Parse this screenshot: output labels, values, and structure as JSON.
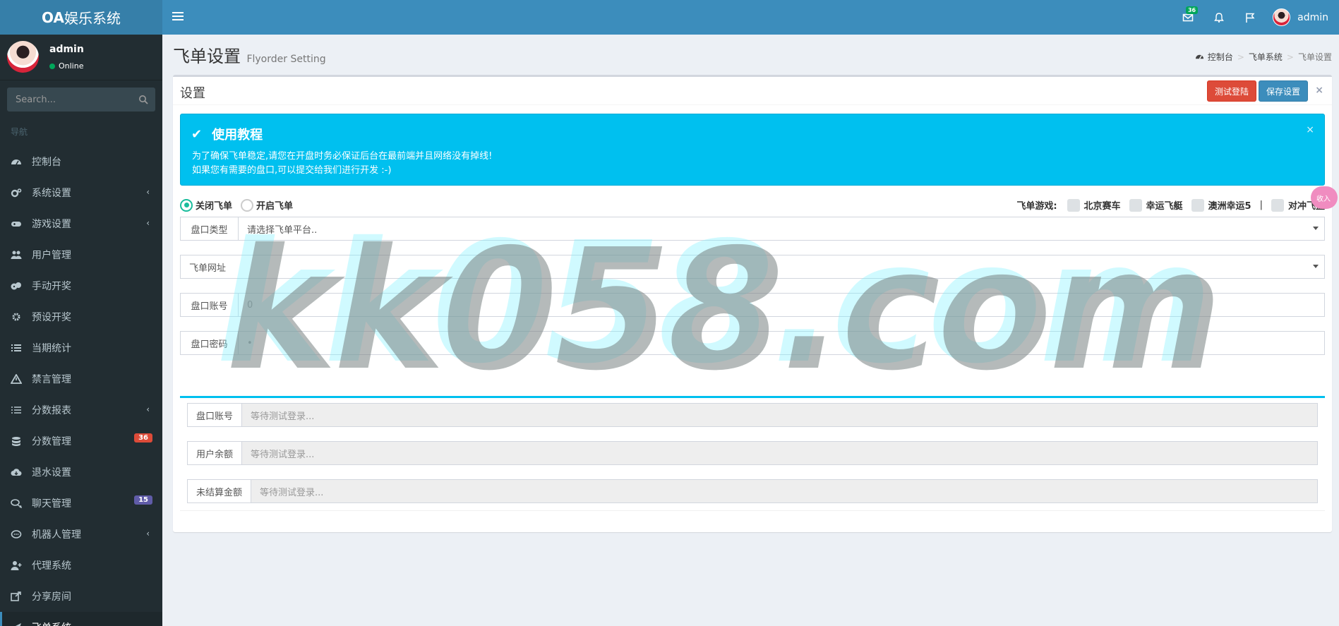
{
  "app": {
    "brand_bold": "OA",
    "brand_rest": "娱乐系统"
  },
  "topbar": {
    "mail_badge": "36",
    "user": "admin",
    "icons": [
      "menu-icon",
      "mail-icon",
      "bell-icon",
      "flag-icon"
    ]
  },
  "sidebar": {
    "user": {
      "name": "admin",
      "status": "Online"
    },
    "search_placeholder": "Search...",
    "nav_header": "导航",
    "items": [
      {
        "label": "控制台",
        "icon": "dashboard-icon"
      },
      {
        "label": "系统设置",
        "icon": "cogs-icon",
        "chevron": "‹"
      },
      {
        "label": "游戏设置",
        "icon": "gamepad-icon",
        "chevron": "‹"
      },
      {
        "label": "用户管理",
        "icon": "users-icon"
      },
      {
        "label": "手动开奖",
        "icon": "dice-icon"
      },
      {
        "label": "预设开奖",
        "icon": "gear-icon"
      },
      {
        "label": "当期统计",
        "icon": "list-icon"
      },
      {
        "label": "禁言管理",
        "icon": "warning-icon"
      },
      {
        "label": "分数报表",
        "icon": "list-ol-icon",
        "chevron": "‹"
      },
      {
        "label": "分数管理",
        "icon": "database-icon",
        "badge": "36",
        "badge_color": "#dd4b39"
      },
      {
        "label": "退水设置",
        "icon": "cloud-download-icon"
      },
      {
        "label": "聊天管理",
        "icon": "comments-icon",
        "badge": "15",
        "badge_color": "#605ca8"
      },
      {
        "label": "机器人管理",
        "icon": "comment-icon",
        "chevron": "‹"
      },
      {
        "label": "代理系统",
        "icon": "user-plus-icon"
      },
      {
        "label": "分享房间",
        "icon": "share-icon"
      },
      {
        "label": "飞单系统",
        "icon": "plane-icon",
        "chevron": "⌄"
      }
    ]
  },
  "header": {
    "title": "飞单设置",
    "subtitle": "Flyorder Setting",
    "breadcrumb": [
      "控制台",
      "飞单系统",
      "飞单设置"
    ]
  },
  "box": {
    "title": "设置",
    "test_button": "测试登陆",
    "save_button": "保存设置",
    "close": "×"
  },
  "callout": {
    "title": "使用教程",
    "line1": "为了确保飞单稳定,请您在开盘时务必保证后台在最前端并且网络没有掉线!",
    "line2": "如果您有需要的盘口,可以提交给我们进行开发 :-)",
    "close": "×"
  },
  "modes": {
    "off": "关闭飞单",
    "on": "开启飞单",
    "selected": "off"
  },
  "games": {
    "label": "飞单游戏:",
    "items": [
      "北京赛车",
      "幸运飞艇",
      "澳洲幸运5"
    ],
    "separator": "|",
    "extra": "对冲飞盘"
  },
  "form": {
    "platform_label": "盘口类型",
    "platform_value": "请选择飞单平台..",
    "url_value": "飞单网址",
    "account_label": "盘口账号",
    "account_value": "0",
    "password_label": "盘口密码",
    "password_value": "•"
  },
  "status": {
    "account_label": "盘口账号",
    "balance_label": "用户余额",
    "unsettled_label": "未结算金额",
    "placeholder": "等待测试登录..."
  },
  "watermark": "kk058.com",
  "side_badge": "收入"
}
